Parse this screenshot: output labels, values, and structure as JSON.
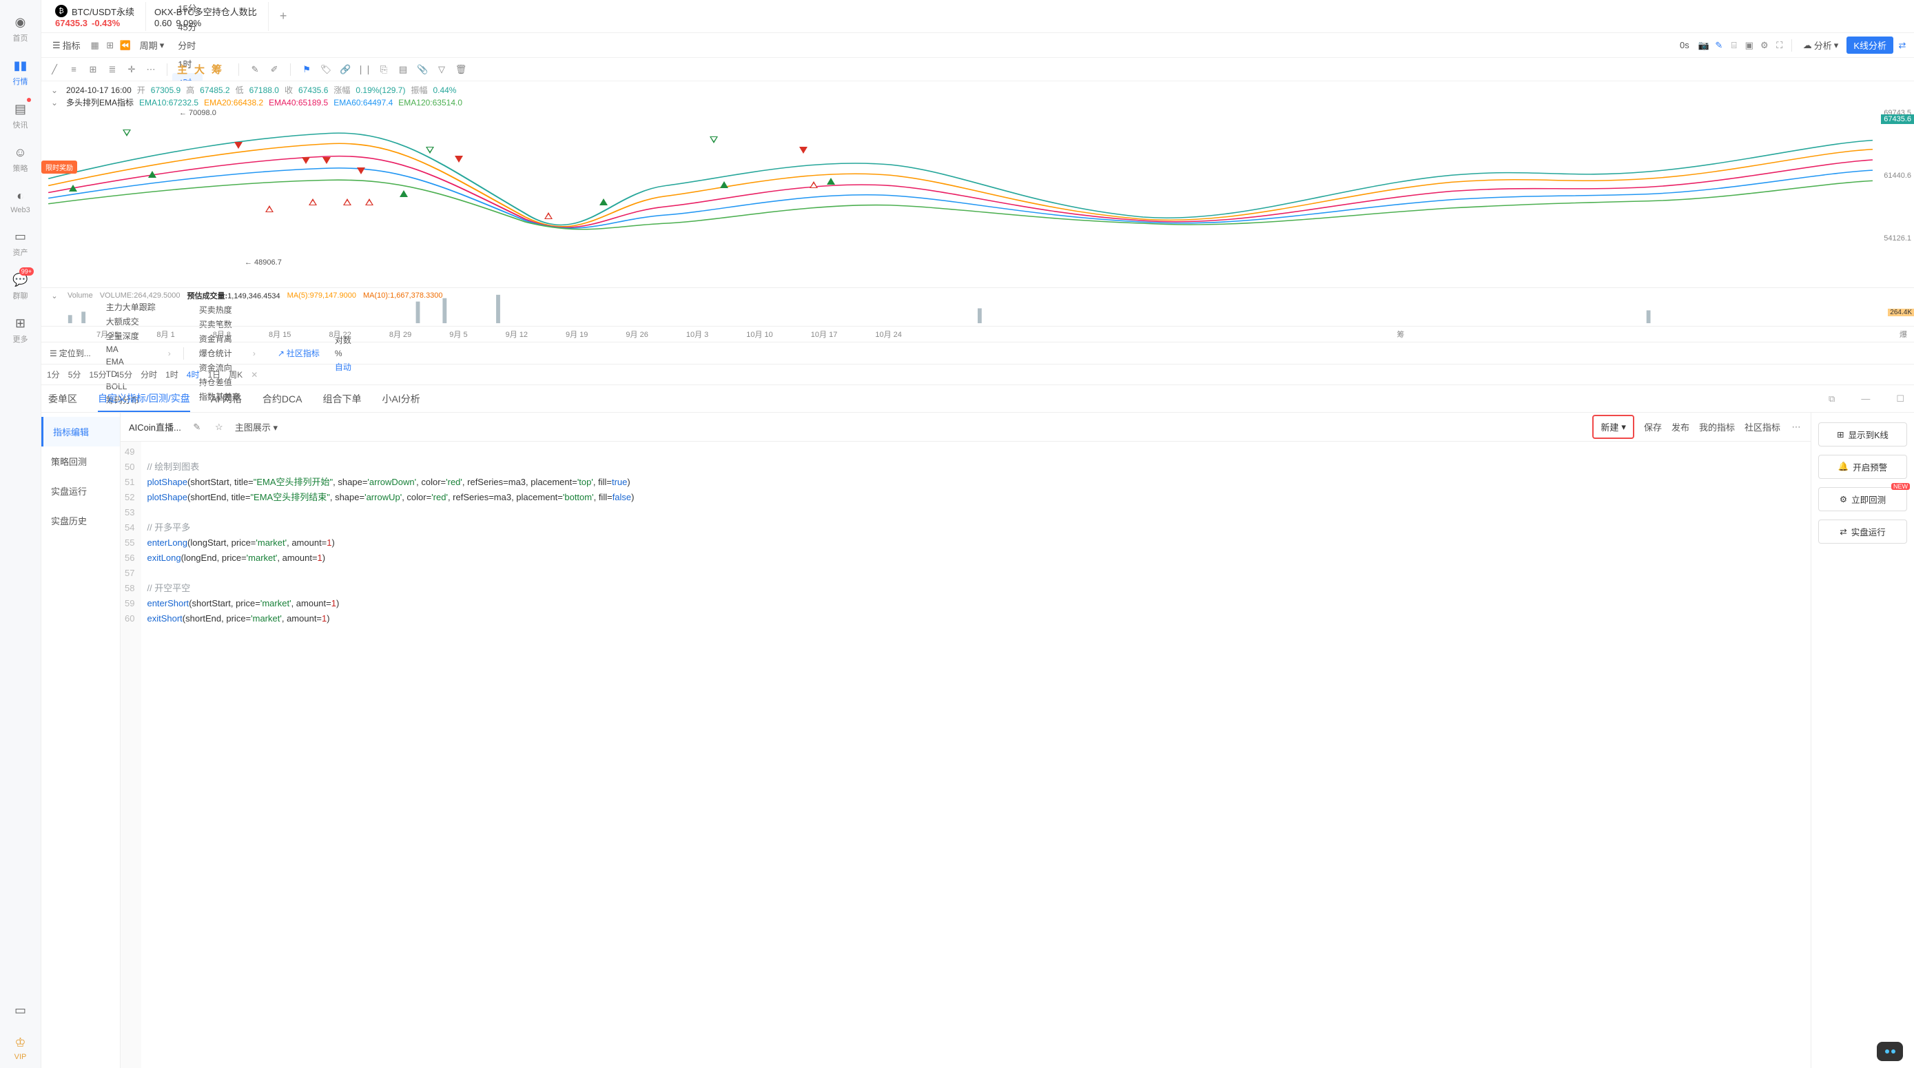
{
  "sidebar": [
    {
      "label": "首页",
      "icon": "globe"
    },
    {
      "label": "行情",
      "icon": "chart",
      "active": true
    },
    {
      "label": "快讯",
      "icon": "news",
      "dot": true
    },
    {
      "label": "策略",
      "icon": "robot"
    },
    {
      "label": "Web3",
      "icon": "web3"
    },
    {
      "label": "资产",
      "icon": "wallet"
    },
    {
      "label": "群聊",
      "icon": "chat",
      "badge": "99+"
    },
    {
      "label": "更多",
      "icon": "grid"
    }
  ],
  "sidebar_bottom": [
    {
      "label": "",
      "icon": "phone"
    },
    {
      "label": "VIP",
      "icon": "vip"
    }
  ],
  "tabs": [
    {
      "title": "BTC/USDT永续",
      "price": "67435.3",
      "change": "-0.43%",
      "active": true,
      "hasIcon": true
    },
    {
      "title": "OKX-BTC多空持仓人数比",
      "price": "0.60",
      "change": "9.09%"
    }
  ],
  "toolbar": {
    "indicator": "指标",
    "period": "周期",
    "tf": [
      "1分",
      "5分",
      "15分",
      "45分",
      "分时",
      "1时",
      "4时",
      "1日",
      "周K"
    ],
    "tf_active": "4时",
    "right": {
      "0s": "0s",
      "analysis": "分析",
      "kline": "K线分析"
    }
  },
  "drawbar_gold": [
    "主",
    "大",
    "筹"
  ],
  "chart": {
    "info": {
      "time": "2024-10-17 16:00",
      "open_l": "开",
      "open": "67305.9",
      "high_l": "高",
      "high": "67485.2",
      "low_l": "低",
      "low": "67188.0",
      "close_l": "收",
      "close": "67435.6",
      "chg_l": "涨幅",
      "chg": "0.19%(129.7)",
      "amp_l": "振幅",
      "amp": "0.44%"
    },
    "ema_label": "多头排列EMA指标",
    "ema": [
      {
        "l": "EMA10:67232.5",
        "c": "ci-green"
      },
      {
        "l": "EMA20:66438.2",
        "c": "ci-orange"
      },
      {
        "l": "EMA40:65189.5",
        "c": "ci-pink"
      },
      {
        "l": "EMA60:64497.4",
        "c": "ci-blue"
      },
      {
        "l": "EMA120:63514.0",
        "c": "ci-teal"
      }
    ],
    "axis": [
      "69743.5",
      "61440.6",
      "54126.1"
    ],
    "current": "67435.6",
    "annot_high": "← 70098.0",
    "annot_low": "← 48906.7",
    "reward": "限时奖励"
  },
  "vol": {
    "label": "Volume",
    "val": "VOLUME:264,429.5000",
    "est_l": "预估成交量:",
    "est": "1,149,346.4534",
    "ma5": "MA(5):979,147.9000",
    "ma10": "MA(10):1,667,378.3300",
    "tag": "264.4K"
  },
  "dates": [
    "7月 25",
    "8月 1",
    "8月 8",
    "8月 15",
    "8月 22",
    "8月 29",
    "9月 5",
    "9月 12",
    "9月 19",
    "9月 26",
    "10月 3",
    "10月 10",
    "10月 17",
    "10月 24"
  ],
  "dates_suffix": [
    "筹",
    "爆"
  ],
  "indic": {
    "locate": "定位到...",
    "items": [
      "主力大单跟踪",
      "大额成交",
      "全量深度",
      "MA",
      "EMA",
      "TD",
      "BOLL",
      "筹码分布"
    ],
    "items2": [
      "买卖热度",
      "买卖笔数",
      "资金背离",
      "爆仓统计",
      "资金流向",
      "持仓差值",
      "指数基差率"
    ],
    "community": "社区指标",
    "right": [
      "对数",
      "%",
      "自动"
    ]
  },
  "tf2": [
    "1分",
    "5分",
    "15分",
    "45分",
    "分时",
    "1时",
    "4时",
    "1日",
    "周K"
  ],
  "tf2_active": "4时",
  "bp": {
    "tabs": [
      "委单区",
      "自定义指标/回测/实盘",
      "AI 网格",
      "合约DCA",
      "组合下单",
      "小AI分析"
    ],
    "tabs_active": 1,
    "side": [
      "指标编辑",
      "策略回测",
      "实盘运行",
      "实盘历史"
    ],
    "side_active": 0,
    "tb": {
      "name": "AICoin直播...",
      "main": "主图展示",
      "new": "新建",
      "save": "保存",
      "pub": "发布",
      "mine": "我的指标",
      "comm": "社区指标"
    },
    "actions": {
      "show": "显示到K线",
      "alert": "开启预警",
      "backtest": "立即回测",
      "run": "实盘运行",
      "new": "NEW"
    }
  },
  "code": [
    {
      "n": 49,
      "t": ""
    },
    {
      "n": 50,
      "t": "// 绘制到图表",
      "cls": "comment"
    },
    {
      "n": 51,
      "parts": [
        [
          "func",
          "plotShape"
        ],
        [
          "",
          "(shortStart, title="
        ],
        [
          "str",
          "\"EMA空头排列开始\""
        ],
        [
          "",
          ", shape="
        ],
        [
          "str",
          "'arrowDown'"
        ],
        [
          "",
          ", color="
        ],
        [
          "str",
          "'red'"
        ],
        [
          "",
          ", refSeries=ma3, placement="
        ],
        [
          "str",
          "'top'"
        ],
        [
          "",
          ", fill="
        ],
        [
          "func",
          "true"
        ],
        [
          "",
          ")"
        ]
      ]
    },
    {
      "n": 52,
      "parts": [
        [
          "func",
          "plotShape"
        ],
        [
          "",
          "(shortEnd, title="
        ],
        [
          "str",
          "\"EMA空头排列结束\""
        ],
        [
          "",
          ", shape="
        ],
        [
          "str",
          "'arrowUp'"
        ],
        [
          "",
          ", color="
        ],
        [
          "str",
          "'red'"
        ],
        [
          "",
          ", refSeries=ma3, placement="
        ],
        [
          "str",
          "'bottom'"
        ],
        [
          "",
          ", fill="
        ],
        [
          "func",
          "false"
        ],
        [
          "",
          ")"
        ]
      ]
    },
    {
      "n": 53,
      "t": ""
    },
    {
      "n": 54,
      "t": "// 开多平多",
      "cls": "comment"
    },
    {
      "n": 55,
      "parts": [
        [
          "func",
          "enterLong"
        ],
        [
          "",
          "(longStart, price="
        ],
        [
          "str",
          "'market'"
        ],
        [
          "",
          ", amount="
        ],
        [
          "num",
          "1"
        ],
        [
          "",
          ")"
        ]
      ]
    },
    {
      "n": 56,
      "parts": [
        [
          "func",
          "exitLong"
        ],
        [
          "",
          "(longEnd, price="
        ],
        [
          "str",
          "'market'"
        ],
        [
          "",
          ", amount="
        ],
        [
          "num",
          "1"
        ],
        [
          "",
          ")"
        ]
      ]
    },
    {
      "n": 57,
      "t": ""
    },
    {
      "n": 58,
      "t": "// 开空平空",
      "cls": "comment"
    },
    {
      "n": 59,
      "parts": [
        [
          "func",
          "enterShort"
        ],
        [
          "",
          "(shortStart, price="
        ],
        [
          "str",
          "'market'"
        ],
        [
          "",
          ", amount="
        ],
        [
          "num",
          "1"
        ],
        [
          "",
          ")"
        ]
      ]
    },
    {
      "n": 60,
      "parts": [
        [
          "func",
          "exitShort"
        ],
        [
          "",
          "(shortEnd, price="
        ],
        [
          "str",
          "'market'"
        ],
        [
          "",
          ", amount="
        ],
        [
          "num",
          "1"
        ],
        [
          "",
          ")"
        ]
      ]
    }
  ],
  "chart_data": {
    "type": "candlestick",
    "symbol": "BTC/USDT Perpetual",
    "timeframe": "4H",
    "date_range": [
      "2024-07-25",
      "2024-10-24"
    ],
    "visible_high": 70098.0,
    "visible_low": 48906.7,
    "last_close": 67435.6,
    "ylim": [
      54126.1,
      69743.5
    ],
    "overlays": [
      "EMA10",
      "EMA20",
      "EMA40",
      "EMA60",
      "EMA120"
    ],
    "signals": [
      {
        "type": "long_open",
        "shape": "arrowUp",
        "fill": true,
        "color": "green",
        "approx_date": "7月23"
      },
      {
        "type": "long_open",
        "shape": "arrowUp",
        "fill": true,
        "color": "green",
        "approx_date": "7月29"
      },
      {
        "type": "short_open",
        "shape": "arrowDown",
        "fill": true,
        "color": "red",
        "approx_date": "8月3"
      },
      {
        "type": "long_close",
        "shape": "arrowDown",
        "fill": false,
        "color": "green",
        "approx_date": "7月24"
      },
      {
        "type": "short_close",
        "shape": "arrowUp",
        "fill": false,
        "color": "red",
        "approx_date": "8月8"
      },
      {
        "type": "short_open",
        "shape": "arrowDown",
        "fill": true,
        "color": "red",
        "approx_date": "8月12"
      },
      {
        "type": "short_open",
        "shape": "arrowDown",
        "fill": true,
        "color": "red",
        "approx_date": "8月14"
      },
      {
        "type": "short_close",
        "shape": "arrowUp",
        "fill": false,
        "color": "red",
        "approx_date": "8月13"
      },
      {
        "type": "short_open",
        "shape": "arrowDown",
        "fill": true,
        "color": "red",
        "approx_date": "8月17"
      },
      {
        "type": "short_close",
        "shape": "arrowUp",
        "fill": false,
        "color": "red",
        "approx_date": "8月18"
      },
      {
        "type": "short_close",
        "shape": "arrowUp",
        "fill": false,
        "color": "red",
        "approx_date": "8月20"
      },
      {
        "type": "long_open",
        "shape": "arrowUp",
        "fill": true,
        "color": "green",
        "approx_date": "8月24"
      },
      {
        "type": "long_close",
        "shape": "arrowDown",
        "fill": false,
        "color": "green",
        "approx_date": "8月28"
      },
      {
        "type": "short_open",
        "shape": "arrowDown",
        "fill": true,
        "color": "red",
        "approx_date": "8月30"
      },
      {
        "type": "short_close",
        "shape": "arrowUp",
        "fill": false,
        "color": "red",
        "approx_date": "9月9"
      },
      {
        "type": "long_open",
        "shape": "arrowUp",
        "fill": true,
        "color": "green",
        "approx_date": "9月14"
      },
      {
        "type": "long_close",
        "shape": "arrowDown",
        "fill": false,
        "color": "green",
        "approx_date": "10月2"
      },
      {
        "type": "long_open",
        "shape": "arrowUp",
        "fill": true,
        "color": "green",
        "approx_date": "10月3"
      },
      {
        "type": "short_open",
        "shape": "arrowDown",
        "fill": true,
        "color": "red",
        "approx_date": "10月11"
      },
      {
        "type": "short_close",
        "shape": "arrowUp",
        "fill": false,
        "color": "red",
        "approx_date": "10月13"
      },
      {
        "type": "long_open",
        "shape": "arrowUp",
        "fill": true,
        "color": "green",
        "approx_date": "10月14"
      }
    ]
  }
}
